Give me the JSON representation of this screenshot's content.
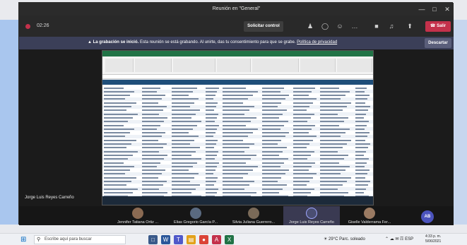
{
  "window": {
    "title": "Reunión en \"General\"",
    "min": "—",
    "max": "□",
    "close": "✕"
  },
  "toolbar": {
    "timer": "02:26",
    "request_control": "Solicitar control",
    "leave": "Salir",
    "icons": [
      "people-icon",
      "chat-icon",
      "reactions-icon",
      "more-icon",
      "camera-off-icon",
      "mic-off-icon",
      "share-icon"
    ]
  },
  "banner": {
    "bold": "La grabación se inició.",
    "text": "Esta reunión se está grabando. Al unirte, das tu consentimiento para que se grabe.",
    "link": "Política de privacidad",
    "dismiss": "Descartar"
  },
  "stage": {
    "presenter": "Jorge Luis Reyes Carreño"
  },
  "participants": [
    {
      "name": "Jennifer Tatiana Ortiz ..."
    },
    {
      "name": "Elias Gregorio García P..."
    },
    {
      "name": "Silvia Juliana Guerrero..."
    },
    {
      "name": "Jorge Luis Reyes Carreño"
    },
    {
      "name": "Giselle Valderrama Fer..."
    }
  ],
  "avatar_initials": "AB",
  "taskbar": {
    "search_placeholder": "Escribe aquí para buscar",
    "weather": "29°C Parc. soleado",
    "lang": "ESP",
    "time": "4:33 p. m.",
    "date": "5/06/2021"
  },
  "colors": {
    "leave": "#c4314b",
    "banner": "#3b3f58",
    "avatar": "#4b53bc",
    "excel": "#217346"
  }
}
